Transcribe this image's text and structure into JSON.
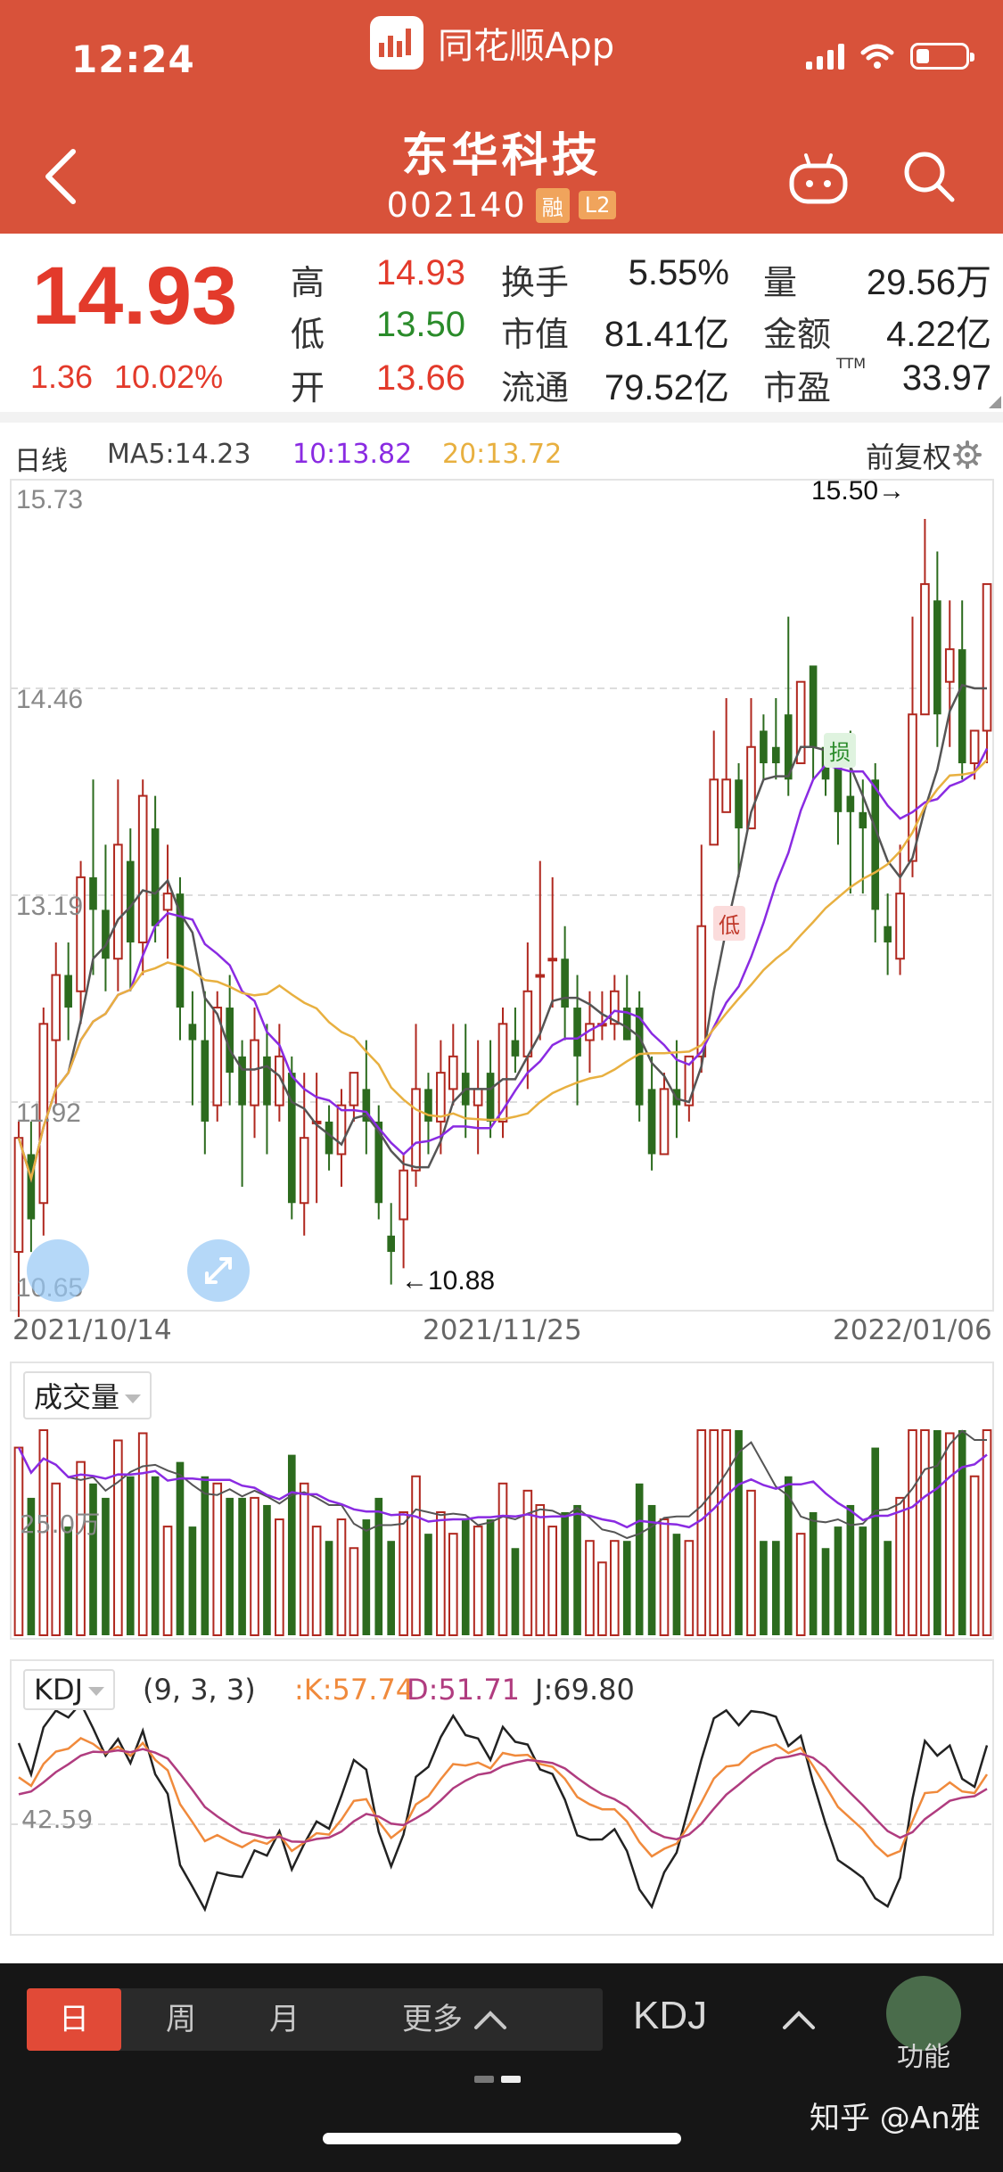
{
  "status_bar": {
    "time": "12:24",
    "app_name": "同花顺App"
  },
  "header": {
    "stock_name": "东华科技",
    "stock_code": "002140",
    "tag_margin": "融",
    "tag_level": "L2"
  },
  "quote": {
    "price": "14.93",
    "change": "1.36",
    "change_pct": "10.02%",
    "rows": [
      [
        {
          "label": "高",
          "value": "14.93",
          "color": "red"
        },
        {
          "label": "换手",
          "value": "5.55%",
          "color": "dark"
        },
        {
          "label": "量",
          "value": "29.56万",
          "color": "dark"
        }
      ],
      [
        {
          "label": "低",
          "value": "13.50",
          "color": "green"
        },
        {
          "label": "市值",
          "value": "81.41亿",
          "color": "dark"
        },
        {
          "label": "金额",
          "value": "4.22亿",
          "color": "dark"
        }
      ],
      [
        {
          "label": "开",
          "value": "13.66",
          "color": "red"
        },
        {
          "label": "流通",
          "value": "79.52亿",
          "color": "dark"
        },
        {
          "label": "市盈",
          "value": "33.97",
          "color": "dark",
          "sup": "TTM"
        }
      ]
    ]
  },
  "kline": {
    "period_label": "日线",
    "ma5": "MA5:14.23",
    "ma10": "10:13.82",
    "ma20": "20:13.72",
    "adjust_label": "前复权",
    "y_ticks": [
      "15.73",
      "14.46",
      "13.19",
      "11.92",
      "10.65"
    ],
    "high_marker": "15.50→",
    "low_marker": "←10.88",
    "signal_stop": "损",
    "signal_low": "低",
    "dates": [
      "2021/10/14",
      "2021/11/25",
      "2022/01/06"
    ],
    "colors": {
      "up": "#b0281f",
      "down": "#2c6b1e",
      "ma5": "#555555",
      "ma10": "#8a2be2",
      "ma20": "#e8b040"
    }
  },
  "chart_data": {
    "type": "candlestick",
    "ylim": [
      10.65,
      15.73
    ],
    "candles": [
      [
        11.0,
        11.7,
        10.6,
        11.8
      ],
      [
        11.6,
        11.2,
        11.0,
        11.8
      ],
      [
        11.3,
        12.4,
        11.1,
        12.5
      ],
      [
        12.3,
        12.7,
        11.9,
        12.9
      ],
      [
        12.7,
        12.5,
        12.3,
        12.9
      ],
      [
        12.6,
        13.3,
        12.4,
        13.4
      ],
      [
        13.3,
        13.1,
        12.7,
        13.9
      ],
      [
        13.1,
        12.8,
        12.6,
        13.5
      ],
      [
        12.8,
        13.5,
        12.6,
        13.9
      ],
      [
        13.4,
        12.9,
        12.6,
        13.6
      ],
      [
        12.9,
        13.8,
        12.7,
        13.9
      ],
      [
        13.6,
        13.0,
        12.9,
        13.8
      ],
      [
        13.1,
        13.2,
        12.8,
        13.5
      ],
      [
        13.2,
        12.5,
        12.3,
        13.3
      ],
      [
        12.4,
        12.3,
        11.9,
        12.6
      ],
      [
        12.3,
        11.8,
        11.6,
        12.6
      ],
      [
        11.9,
        12.5,
        11.8,
        12.6
      ],
      [
        12.5,
        12.1,
        11.9,
        12.7
      ],
      [
        12.2,
        11.9,
        11.4,
        12.3
      ],
      [
        11.9,
        12.3,
        11.7,
        12.5
      ],
      [
        12.2,
        11.9,
        11.6,
        12.4
      ],
      [
        11.9,
        12.2,
        11.8,
        12.4
      ],
      [
        12.1,
        11.3,
        11.2,
        12.2
      ],
      [
        11.3,
        11.7,
        11.1,
        12.1
      ],
      [
        11.8,
        11.8,
        11.3,
        12.1
      ],
      [
        11.8,
        11.6,
        11.5,
        11.9
      ],
      [
        11.6,
        11.9,
        11.4,
        12.0
      ],
      [
        11.9,
        12.1,
        11.8,
        12.1
      ],
      [
        12.0,
        11.8,
        11.6,
        12.3
      ],
      [
        11.8,
        11.3,
        11.2,
        11.9
      ],
      [
        11.1,
        11.0,
        10.8,
        11.3
      ],
      [
        11.2,
        11.5,
        10.9,
        11.6
      ],
      [
        11.5,
        12.0,
        11.4,
        12.4
      ],
      [
        12.0,
        11.8,
        11.6,
        12.1
      ],
      [
        11.8,
        12.1,
        11.6,
        12.3
      ],
      [
        12.0,
        12.2,
        11.9,
        12.4
      ],
      [
        12.1,
        11.9,
        11.7,
        12.4
      ],
      [
        11.9,
        12.0,
        11.6,
        12.3
      ],
      [
        12.1,
        11.8,
        11.7,
        12.3
      ],
      [
        11.8,
        12.4,
        11.7,
        12.5
      ],
      [
        12.3,
        12.2,
        12.1,
        12.5
      ],
      [
        12.2,
        12.6,
        12.0,
        12.9
      ],
      [
        12.7,
        12.7,
        12.3,
        13.4
      ],
      [
        12.8,
        12.8,
        12.5,
        13.3
      ],
      [
        12.8,
        12.5,
        12.3,
        13.0
      ],
      [
        12.5,
        12.2,
        11.9,
        12.7
      ],
      [
        12.3,
        12.4,
        12.1,
        12.6
      ],
      [
        12.4,
        12.4,
        12.3,
        12.6
      ],
      [
        12.4,
        12.6,
        12.3,
        12.7
      ],
      [
        12.5,
        12.3,
        12.3,
        12.7
      ],
      [
        12.5,
        11.9,
        11.8,
        12.6
      ],
      [
        12.0,
        11.6,
        11.5,
        12.2
      ],
      [
        11.6,
        12.0,
        11.6,
        12.1
      ],
      [
        12.0,
        11.9,
        11.7,
        12.3
      ],
      [
        11.9,
        12.2,
        11.8,
        12.1
      ],
      [
        12.2,
        13.0,
        12.1,
        13.5
      ],
      [
        13.5,
        13.9,
        13.6,
        14.2
      ],
      [
        13.7,
        13.9,
        13.7,
        14.4
      ],
      [
        13.9,
        13.6,
        13.3,
        14.0
      ],
      [
        13.6,
        14.1,
        13.6,
        14.4
      ],
      [
        14.2,
        14.0,
        13.9,
        14.3
      ],
      [
        14.1,
        14.0,
        13.9,
        14.4
      ],
      [
        14.3,
        13.9,
        13.8,
        14.9
      ],
      [
        14.0,
        14.5,
        14.1,
        14.3
      ],
      [
        14.6,
        14.1,
        13.9,
        14.4
      ],
      [
        14.1,
        13.9,
        13.8,
        14.1
      ],
      [
        14.0,
        13.7,
        13.5,
        14.0
      ],
      [
        13.8,
        13.7,
        13.2,
        14.2
      ],
      [
        13.7,
        13.6,
        13.2,
        13.9
      ],
      [
        13.9,
        13.1,
        12.9,
        14.0
      ],
      [
        13.0,
        12.9,
        12.7,
        13.2
      ],
      [
        12.8,
        13.2,
        12.7,
        13.5
      ],
      [
        13.4,
        14.3,
        13.3,
        14.9
      ],
      [
        14.3,
        15.1,
        14.4,
        15.5
      ],
      [
        15.0,
        14.3,
        14.1,
        15.3
      ],
      [
        14.5,
        14.7,
        14.1,
        15.0
      ],
      [
        14.7,
        14.0,
        13.9,
        15.0
      ],
      [
        14.0,
        14.2,
        13.9,
        14.2
      ],
      [
        14.2,
        15.1,
        14.0,
        15.1
      ]
    ],
    "kdj": {
      "K": "57.74",
      "D": "51.71",
      "J": "69.80",
      "params": "(9, 3, 3)",
      "tick": "42.59"
    },
    "volume": {
      "label": "成交量",
      "tick": "25.0万"
    }
  },
  "bottom_bar": {
    "periods": [
      "日",
      "周",
      "月",
      "更多"
    ],
    "indicator": "KDJ",
    "func_label": "功能",
    "watermark": "知乎 @An雅"
  }
}
